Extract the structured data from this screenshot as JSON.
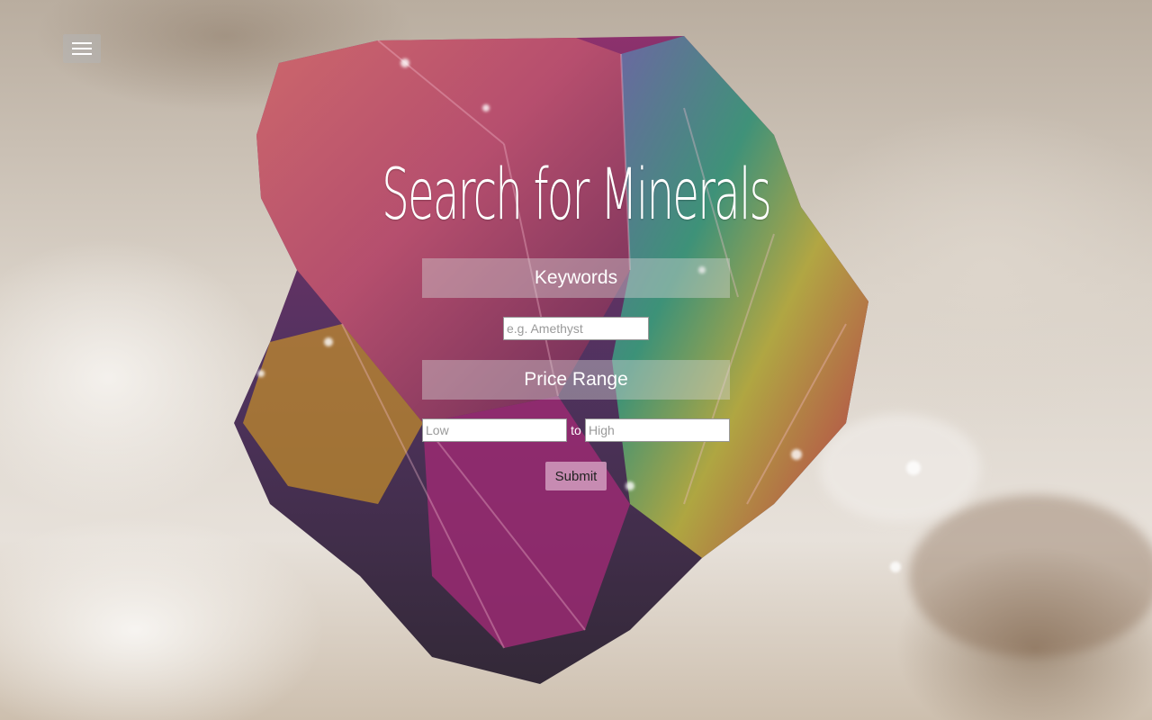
{
  "header": {
    "menu_icon": "hamburger-menu-icon"
  },
  "search": {
    "title": "Search for Minerals",
    "keywords_label": "Keywords",
    "keywords_placeholder": "e.g. Amethyst",
    "price_label": "Price Range",
    "low_placeholder": "Low",
    "to_text": "to",
    "high_placeholder": "High",
    "submit_label": "Submit"
  },
  "colors": {
    "submit_bg": "#cd96b9",
    "label_bg": "#d7d7d7",
    "text": "#ffffff"
  }
}
